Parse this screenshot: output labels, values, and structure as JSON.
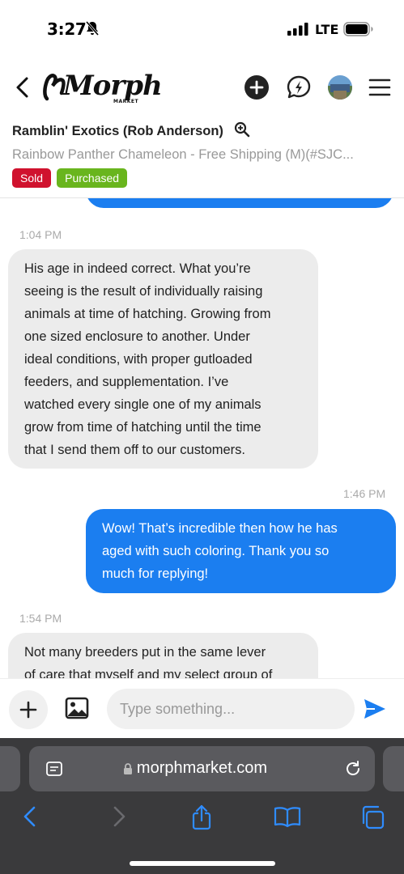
{
  "status_bar": {
    "time": "3:27",
    "network": "LTE"
  },
  "header": {
    "logo_text": "Morph",
    "logo_sub": "MARKET"
  },
  "conversation": {
    "seller": "Ramblin' Exotics (Rob Anderson)",
    "listing": "Rainbow Panther Chameleon - Free Shipping (M)(#SJC...",
    "badges": {
      "sold": "Sold",
      "purchased": "Purchased"
    }
  },
  "messages": [
    {
      "time": "1:04 PM",
      "direction": "incoming",
      "lines": [
        "His age in indeed correct. What you’re",
        "seeing is the result of individually raising",
        "animals at time of hatching. Growing from",
        "one sized enclosure to another. Under",
        "ideal conditions, with proper gutloaded",
        "feeders, and supplementation. I’ve",
        "watched every single one of my animals",
        "grow from time of hatching until the time",
        "that I send them off to our customers."
      ]
    },
    {
      "time": "1:46 PM",
      "direction": "outgoing",
      "lines": [
        "Wow! That’s incredible then how he has",
        "aged with such coloring. Thank you so",
        "much for replying!"
      ]
    },
    {
      "time": "1:54 PM",
      "direction": "incoming",
      "lines": [
        "Not many breeders put in the same lever",
        "of care that myself and my select group of"
      ]
    }
  ],
  "composer": {
    "placeholder": "Type something..."
  },
  "browser": {
    "url": "morphmarket.com"
  },
  "colors": {
    "outgoing_bubble": "#1b7ef0",
    "incoming_bubble": "#ececec",
    "sold": "#d0122e",
    "purchased": "#69b51d",
    "send": "#1b7ef0"
  }
}
